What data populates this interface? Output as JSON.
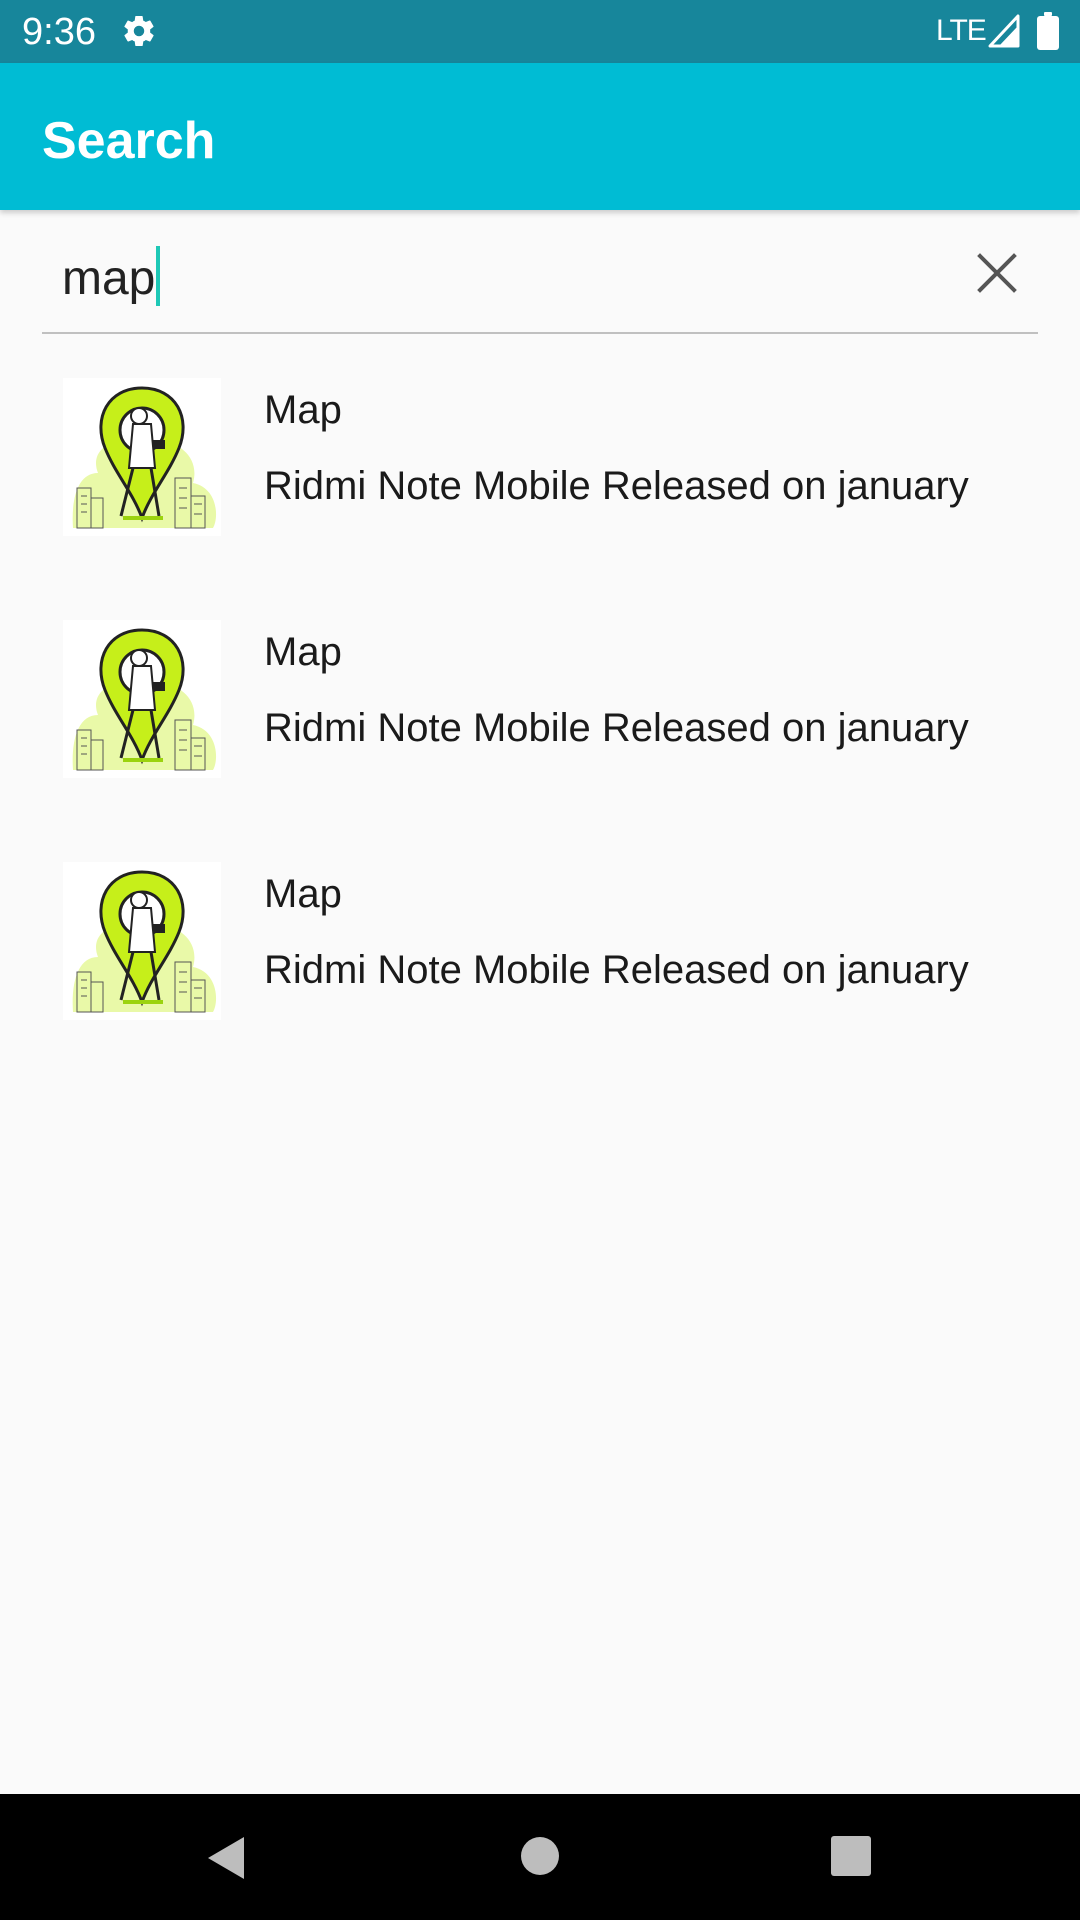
{
  "status_bar": {
    "time": "9:36",
    "network": "LTE"
  },
  "app_bar": {
    "title": "Search"
  },
  "search": {
    "value": "map"
  },
  "results": [
    {
      "title": "Map",
      "subtitle": "Ridmi Note Mobile Released on january"
    },
    {
      "title": "Map",
      "subtitle": "Ridmi Note Mobile Released on january"
    },
    {
      "title": "Map",
      "subtitle": "Ridmi Note Mobile Released on january"
    }
  ],
  "icons": {
    "settings": "gear-icon",
    "signal": "signal-icon",
    "battery": "battery-icon",
    "clear": "close-icon",
    "back": "back-triangle-icon",
    "home": "home-circle-icon",
    "recents": "recents-square-icon"
  },
  "colors": {
    "status_bar": "#17869b",
    "app_bar": "#00bcd4",
    "caret": "#1ec8b6",
    "thumbnail_pin": "#c6ef1a"
  }
}
